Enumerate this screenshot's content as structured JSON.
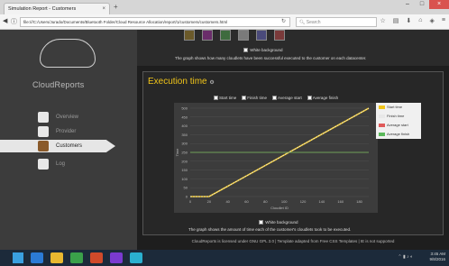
{
  "browser": {
    "tab_title": "Simulation Report - Customers",
    "tab_close": "×",
    "new_tab": "+",
    "url": "file:///C:/Users/Jurado/Documents/Bluetooth Folder/Cloud Resource Allocation/report/1/customers/customers.html",
    "search_placeholder": "Search",
    "window": {
      "minimize": "–",
      "maximize": "□",
      "close": "×"
    }
  },
  "sidebar": {
    "logo_text": "CloudReports",
    "items": [
      {
        "label": "Overview"
      },
      {
        "label": "Provider"
      },
      {
        "label": "Customers"
      },
      {
        "label": "Log"
      }
    ]
  },
  "top_card": {
    "white_bg_label": "White background",
    "description": "The graph shows how many cloudlets have been successful executed to the customer on each datacenter.",
    "swatch_colors": [
      "#6b5a2a",
      "#6a2d6a",
      "#3e6b3e",
      "#7a7a7a",
      "#4a4a7a",
      "#7a3a3a"
    ]
  },
  "execution_card": {
    "title": "Execution time",
    "legend": [
      "Start time",
      "Finish time",
      "Average start",
      "Average finish"
    ],
    "hover_legend": [
      {
        "label": "Start time",
        "color": "#f0c419"
      },
      {
        "label": "Finish time",
        "color": "#e8e8e8"
      },
      {
        "label": "Average start",
        "color": "#e05a5a"
      },
      {
        "label": "Average finish",
        "color": "#5ab85a"
      }
    ],
    "white_bg_label": "White background",
    "description": "The graph shows the amount of time each of the customer's cloudlets took to be executed.",
    "y_ticks": [
      "0",
      "50",
      "100",
      "150",
      "200",
      "250",
      "300",
      "350",
      "400",
      "450",
      "500"
    ],
    "x_ticks": [
      "0",
      "20",
      "40",
      "60",
      "80",
      "100",
      "120",
      "140",
      "160",
      "180"
    ],
    "ylabel": "Time",
    "xlabel": "Cloudlet ID"
  },
  "chart_data": {
    "type": "line",
    "series": [
      {
        "name": "Start time",
        "x": [
          0,
          20,
          190
        ],
        "y": [
          0,
          0,
          500
        ]
      },
      {
        "name": "Finish time",
        "x": [
          0,
          20,
          190
        ],
        "y": [
          0,
          0,
          500
        ]
      },
      {
        "name": "Average start",
        "x": [
          0,
          190
        ],
        "y": [
          250,
          250
        ]
      },
      {
        "name": "Average finish",
        "x": [
          0,
          190
        ],
        "y": [
          250,
          250
        ]
      }
    ],
    "xlim": [
      0,
      190
    ],
    "ylim": [
      0,
      500
    ]
  },
  "footer": {
    "text": "CloudReports is licensed under GNU GPL 3.0 | Template adapted from Free CSS Templates | IE is not supported"
  },
  "taskbar": {
    "app_colors": [
      "#2b7bd6",
      "#e8b830",
      "#3aa04a",
      "#d04a2a",
      "#7a3ad0",
      "#2ab0d0"
    ],
    "tray": "⌃ ▮ ♪ ◐",
    "time": "3:45 AM",
    "date": "9/8/2016"
  }
}
